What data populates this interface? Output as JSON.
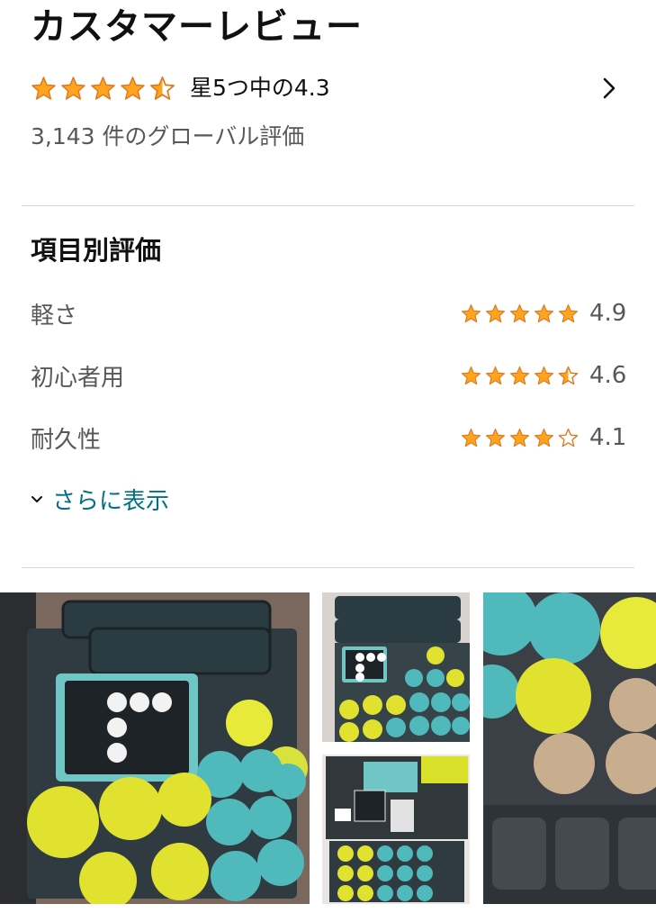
{
  "header": {
    "title": "カスタマーレビュー"
  },
  "overall": {
    "rating": 4.3,
    "stars_filled": 4.5,
    "rating_text": "星5つ中の4.3",
    "global_count_text": "3,143 件のグローバル評価",
    "chevron_icon": "chevron-right-icon"
  },
  "features": {
    "title": "項目別評価",
    "items": [
      {
        "name": "軽さ",
        "score": "4.9",
        "stars": 5
      },
      {
        "name": "初心者用",
        "score": "4.6",
        "stars": 4.5
      },
      {
        "name": "耐久性",
        "score": "4.1",
        "stars": 4
      }
    ],
    "show_more": "さらに表示"
  },
  "photos": {
    "count": 4
  },
  "colors": {
    "star": "#ffa41c",
    "star_stroke": "#de7921",
    "link": "#007185",
    "secondary_text": "#565959",
    "divider": "#d5d9d9"
  }
}
